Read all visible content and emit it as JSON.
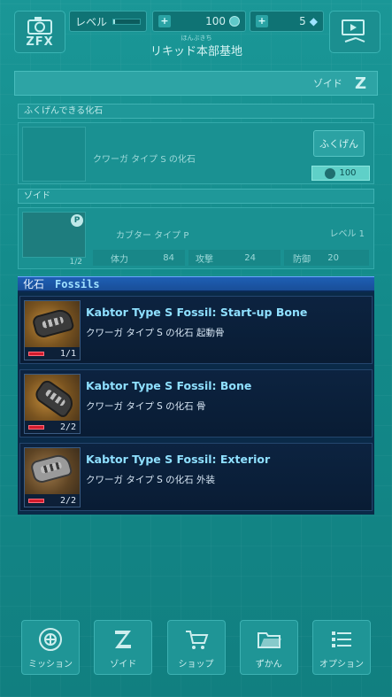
{
  "header": {
    "level_label": "レベル",
    "coins": "100",
    "gems": "5",
    "location_ruby": "ほんぶきち",
    "location": "リキッド本部基地"
  },
  "section_bar": {
    "label": "ゾイド"
  },
  "revive_section": {
    "header": "ふくげんできる化石",
    "fossil_name": "クワーガ タイプ S の化石",
    "revive_button": "ふくげん",
    "cost": "100"
  },
  "zoid_section": {
    "header": "ゾイド",
    "zoid_name": "カブター タイプ P",
    "level": "レベル 1",
    "count": "1/2",
    "stats": [
      {
        "label": "体力",
        "value": "84"
      },
      {
        "label": "攻撃",
        "value": "24"
      },
      {
        "label": "防御",
        "value": "20"
      }
    ]
  },
  "fossils": {
    "title_jp": "化石",
    "title_en": "Fossils",
    "items": [
      {
        "name": "Kabtor Type S Fossil: Start-up Bone",
        "sub": "クワーガ タイプ S の化石 起動骨",
        "count": "1/1"
      },
      {
        "name": "Kabtor Type S Fossil: Bone",
        "sub": "クワーガ タイプ S の化石 骨",
        "count": "2/2"
      },
      {
        "name": "Kabtor Type S Fossil: Exterior",
        "sub": "クワーガ タイプ S の化石 外装",
        "count": "2/2"
      }
    ]
  },
  "nav": {
    "mission": "ミッション",
    "zoid": "ゾイド",
    "shop": "ショップ",
    "zukan": "ずかん",
    "options": "オプション"
  },
  "colors": {
    "background": "#138a8a",
    "fossil_title": "#8fe0ff",
    "fossil_panel": "#0a2a48",
    "red_chip": "#d21b2c"
  }
}
